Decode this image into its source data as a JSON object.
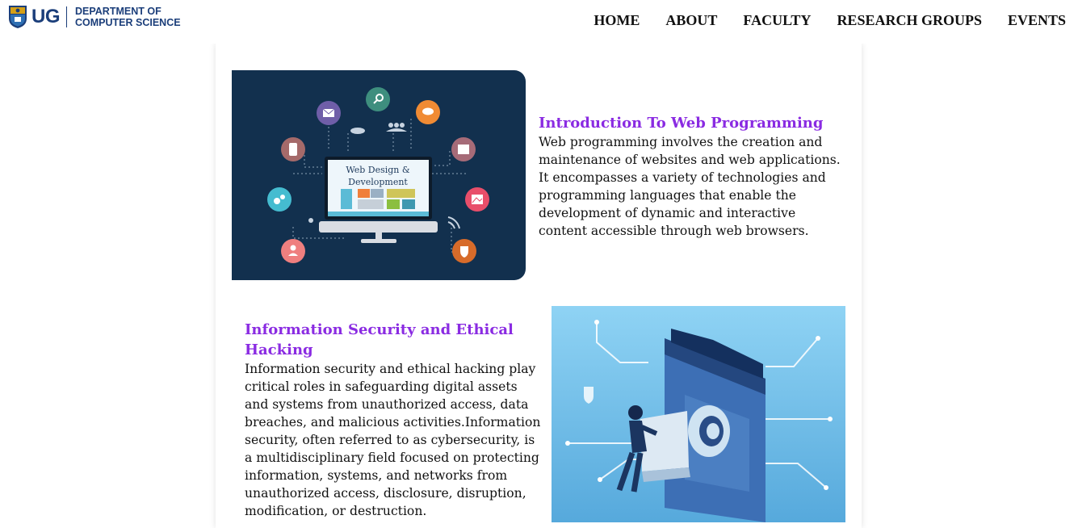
{
  "header": {
    "logo_text": "UG",
    "dept_line1": "DEPARTMENT OF",
    "dept_line2": "COMPUTER SCIENCE",
    "nav": [
      "HOME",
      "ABOUT",
      "FACULTY",
      "RESEARCH GROUPS",
      "EVENTS"
    ]
  },
  "courses": [
    {
      "title": "Introduction To Web Programming",
      "description": "Web programming involves the creation and maintenance of websites and web applications. It encompasses a variety of technologies and programming languages that enable the development of dynamic and interactive content accessible through web browsers.",
      "image_caption_line1": "Web Design &",
      "image_caption_line2": "Development"
    },
    {
      "title": "Information Security and Ethical Hacking",
      "description": "Information security and ethical hacking play critical roles in safeguarding digital assets and systems from unauthorized access, data breaches, and malicious activities.Information security, often referred to as cybersecurity, is a multidisciplinary field focused on protecting information, systems, and networks from unauthorized access, disclosure, disruption, modification, or destruction."
    }
  ],
  "colors": {
    "title_accent": "#8a2be2",
    "brand_blue": "#1b3e7a",
    "web_image_bg": "#12304e",
    "security_image_bg": "#7fc8ee"
  }
}
